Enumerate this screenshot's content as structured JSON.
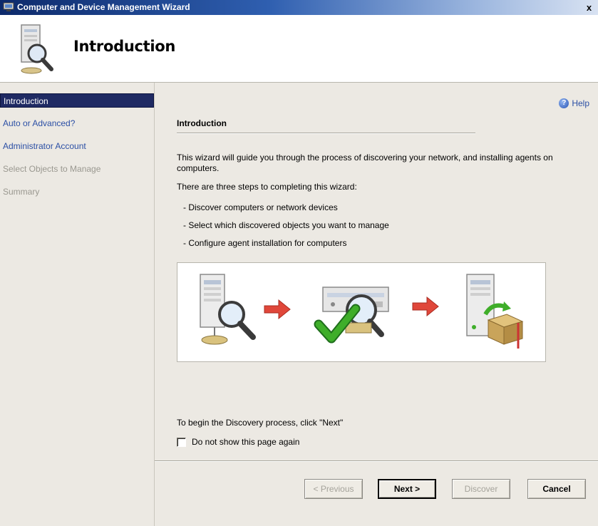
{
  "window": {
    "title": "Computer and Device Management Wizard",
    "close_label": "x"
  },
  "header": {
    "title": "Introduction"
  },
  "nav": {
    "items": [
      {
        "label": "Introduction",
        "state": "selected"
      },
      {
        "label": "Auto or Advanced?",
        "state": "link"
      },
      {
        "label": "Administrator Account",
        "state": "link"
      },
      {
        "label": "Select Objects to Manage",
        "state": "disabled"
      },
      {
        "label": "Summary",
        "state": "disabled"
      }
    ]
  },
  "main": {
    "help_label": "Help",
    "section_title": "Introduction",
    "paragraph1": "This wizard will guide you through the process of discovering your network, and installing agents on computers.",
    "paragraph2": "There are three steps to completing this wizard:",
    "bullets": [
      "- Discover computers or network devices",
      "- Select which discovered objects you want to manage",
      "- Configure agent installation for computers"
    ],
    "begin_text": "To begin the Discovery process, click \"Next\"",
    "checkbox_label": "Do not show this page again",
    "checkbox_checked": false
  },
  "buttons": {
    "previous": "< Previous",
    "next": "Next >",
    "discover": "Discover",
    "cancel": "Cancel"
  },
  "colors": {
    "nav_selected_bg": "#1f2a63",
    "link": "#2b4fa5",
    "arrow": "#e0473a",
    "check": "#3fae2a"
  },
  "icons": [
    "app-icon",
    "magnifier-computer-icon",
    "help-icon",
    "discover-computer-icon",
    "select-objects-icon",
    "install-agent-icon",
    "arrow-right-icon"
  ]
}
